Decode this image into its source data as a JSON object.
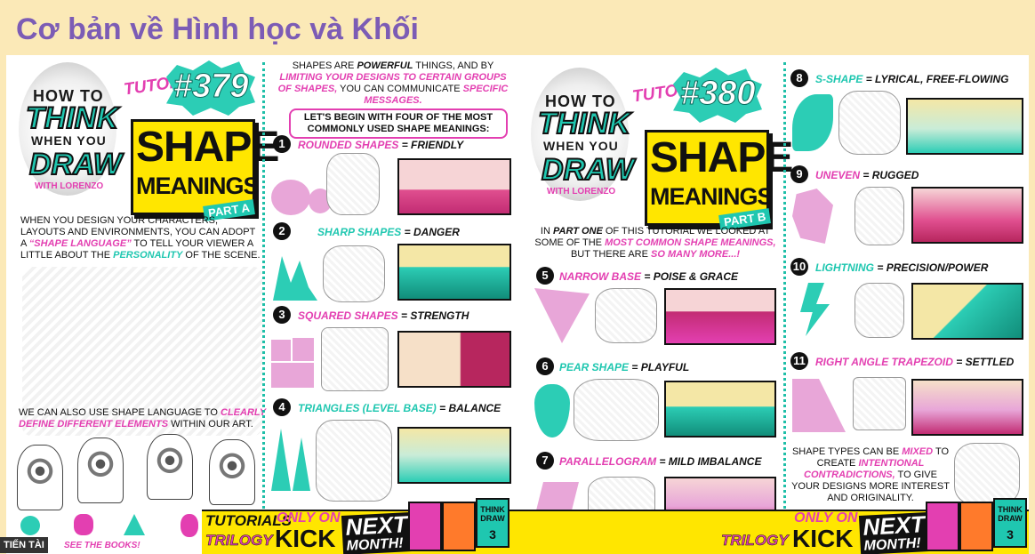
{
  "page": {
    "title": "Cơ bản về Hình học và Khối"
  },
  "left": {
    "logo": {
      "how_to": "HOW TO",
      "think": "THINK",
      "when_you": "WHEN YOU",
      "draw": "DRAW",
      "with": "WITH LORENZO"
    },
    "tutorial_label": "TUTORIAL",
    "tutorial_number": "#379",
    "shape": "SHAPE",
    "meanings": "MEANINGS",
    "part": "PART A",
    "intro": [
      {
        "t": "When you design your characters, layouts and environments, you can adopt a ",
        "c": ""
      },
      {
        "t": "“shape language”",
        "c": "pink"
      },
      {
        "t": " to tell your viewer a little about the ",
        "c": ""
      },
      {
        "t": "personality",
        "c": "teal"
      },
      {
        "t": " of the scene.",
        "c": ""
      }
    ],
    "define": [
      {
        "t": "We can also use shape language to ",
        "c": ""
      },
      {
        "t": "clearly define different elements",
        "c": "pink"
      },
      {
        "t": " within our art.",
        "c": ""
      }
    ],
    "top_text": [
      {
        "t": "Shapes are ",
        "c": ""
      },
      {
        "t": "powerful",
        "c": "bold"
      },
      {
        "t": " things, and by ",
        "c": ""
      },
      {
        "t": "limiting your designs to certain groups of shapes,",
        "c": "pink"
      },
      {
        "t": " you can communicate ",
        "c": ""
      },
      {
        "t": "specific messages.",
        "c": "pink"
      }
    ],
    "begin_banner": "Let's begin with four of the most commonly used shape meanings:",
    "items": [
      {
        "n": "1",
        "name": "Rounded shapes",
        "meaning": "Friendly"
      },
      {
        "n": "2",
        "name": "Sharp shapes",
        "meaning": "Danger"
      },
      {
        "n": "3",
        "name": "Squared shapes",
        "meaning": "Strength"
      },
      {
        "n": "4",
        "name": "Triangles (level base)",
        "meaning": "Balance"
      }
    ],
    "bottom": {
      "tutorials": "TUTORIALS",
      "trilogy": "TRILOGY",
      "only_on": "ONLY ON",
      "kick": "KICK",
      "next": "NEXT",
      "month": "MONTH!",
      "book_title": "THINK DRAW",
      "book_num": "3"
    }
  },
  "right": {
    "tutorial_number": "#380",
    "part": "PART B",
    "intro": [
      {
        "t": "In ",
        "c": ""
      },
      {
        "t": "part one",
        "c": "bold"
      },
      {
        "t": " of this tutorial we looked at some of the ",
        "c": ""
      },
      {
        "t": "most common shape meanings,",
        "c": "pink"
      },
      {
        "t": " but there are ",
        "c": ""
      },
      {
        "t": "so many more...!",
        "c": "pink"
      }
    ],
    "items_mid": [
      {
        "n": "5",
        "name": "Narrow base",
        "meaning": "Poise & Grace"
      },
      {
        "n": "6",
        "name": "Pear shape",
        "meaning": "Playful"
      },
      {
        "n": "7",
        "name": "Parallelogram",
        "meaning": "Mild imbalance"
      }
    ],
    "items_right": [
      {
        "n": "8",
        "name": "S-shape",
        "meaning": "Lyrical, free-flowing"
      },
      {
        "n": "9",
        "name": "Uneven",
        "meaning": "Rugged"
      },
      {
        "n": "10",
        "name": "Lightning",
        "meaning": "Precision/Power"
      },
      {
        "n": "11",
        "name": "Right angle trapezoid",
        "meaning": "Settled"
      }
    ],
    "mixed": [
      {
        "t": "Shape types can be ",
        "c": ""
      },
      {
        "t": "mixed",
        "c": "pink"
      },
      {
        "t": " to create ",
        "c": ""
      },
      {
        "t": "intentional contradictions,",
        "c": "pink"
      },
      {
        "t": " to give your designs more interest and originality.",
        "c": ""
      }
    ]
  },
  "overlay": {
    "tag": "TIẾN TÀI",
    "link": "SEE THE BOOKS!"
  },
  "colors": {
    "pink": "#e33fb1",
    "teal": "#1fc7b0",
    "yellow": "#ffe600",
    "header_bg": "#fbe9b7",
    "title": "#7c5cb5"
  }
}
